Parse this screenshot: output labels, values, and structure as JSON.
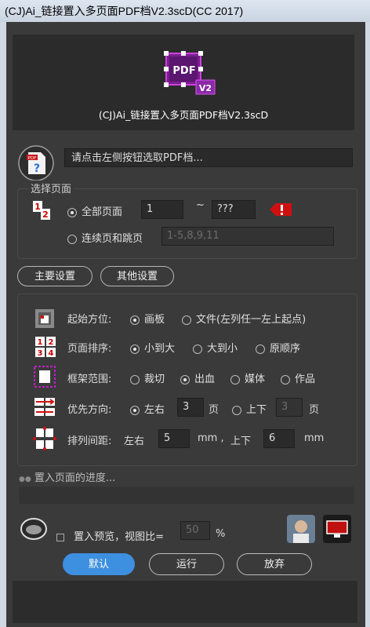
{
  "window": {
    "title": "(CJ)Ai_链接置入多页面PDF档V2.3scD(CC 2017)"
  },
  "banner": {
    "title": "(CJ)Ai_链接置入多页面PDF档V2.3scD",
    "logo_text": "PDF",
    "logo_badge": "V2"
  },
  "file": {
    "path_text": "请点击左侧按钮选取PDF档..."
  },
  "page_select": {
    "legend": "选择页面",
    "all_pages_label": "全部页面",
    "from_value": "1",
    "range_sep": "~",
    "to_value": "???",
    "skip_label": "连续页和跳页",
    "skip_placeholder": "1-5,8,9,11",
    "all_selected": true
  },
  "tabs": {
    "main": "主要设置",
    "other": "其他设置"
  },
  "settings": {
    "origin": {
      "label": "起始方位:",
      "opt1": "画板",
      "opt2": "文件(左列任一左上起点)",
      "selected": "画板"
    },
    "order": {
      "label": "页面排序:",
      "opt1": "小到大",
      "opt2": "大到小",
      "opt3": "原顺序",
      "selected": "小到大"
    },
    "frame": {
      "label": "框架范围:",
      "opt1": "裁切",
      "opt2": "出血",
      "opt3": "媒体",
      "opt4": "作品",
      "selected": "出血"
    },
    "direction": {
      "label": "优先方向:",
      "opt1": "左右",
      "value1": "3",
      "unit1": "页",
      "opt2": "上下",
      "value2": "3",
      "unit2": "页",
      "selected": "左右"
    },
    "spacing": {
      "label": "排列间距:",
      "lr_label": "左右",
      "lr_value": "5",
      "lr_unit": "mm ,",
      "ud_label": "上下",
      "ud_value": "6",
      "ud_unit": "mm"
    }
  },
  "progress": {
    "label": "置入页面的进度..."
  },
  "preview": {
    "label": "置入预览，视图比=",
    "ratio_value": "50",
    "ratio_unit": "%"
  },
  "buttons": {
    "default": "默认",
    "run": "运行",
    "cancel": "放弃"
  },
  "colors": {
    "accent": "#3d8fe0",
    "magenta": "#c020c0",
    "alert": "#d01010"
  }
}
